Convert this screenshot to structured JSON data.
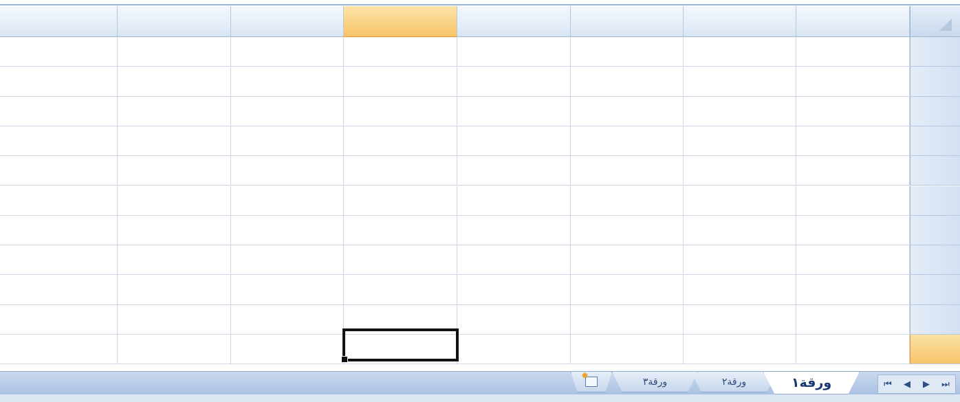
{
  "window": {
    "direction": "rtl"
  },
  "grid": {
    "column_count": 8,
    "row_count": 11,
    "active_column_index": 3,
    "active_row_index": 10,
    "selected_cell_value": ""
  },
  "sheet_tabs": {
    "tabs": [
      {
        "label": "ورقة١",
        "active": true
      },
      {
        "label": "ورقة٢",
        "active": false
      },
      {
        "label": "ورقة٣",
        "active": false
      }
    ],
    "insert_sheet_icon": "insert-sheet-icon",
    "nav_buttons": [
      {
        "icon": "first-sheet-icon",
        "glyph": "⏮"
      },
      {
        "icon": "prev-sheet-icon",
        "glyph": "◀"
      },
      {
        "icon": "next-sheet-icon",
        "glyph": "▶"
      },
      {
        "icon": "last-sheet-icon",
        "glyph": "⏭"
      }
    ]
  },
  "colors": {
    "header_blue": "#dbe6f4",
    "active_header_orange": "#f8c46a",
    "grid_line": "#d0d7e5",
    "selection_border": "#111111"
  }
}
